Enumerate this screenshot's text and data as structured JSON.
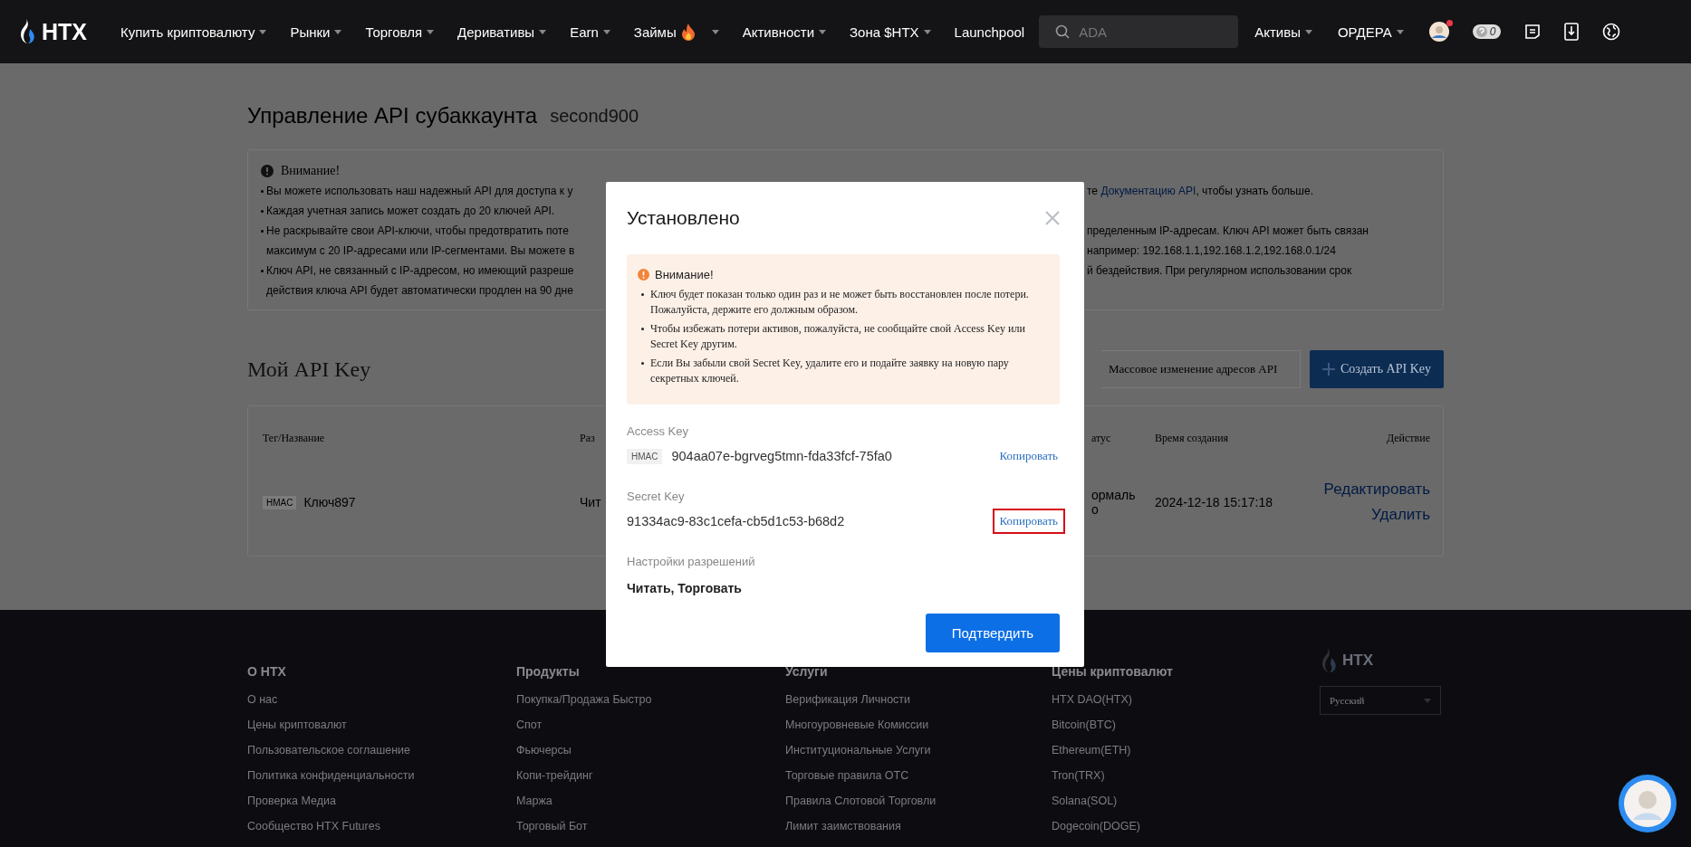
{
  "nav": {
    "logo": "HTX",
    "menu": [
      {
        "label": "Купить криптовалюту",
        "kind": "dropdown",
        "hot": false
      },
      {
        "label": "Рынки",
        "kind": "dropdown",
        "hot": false
      },
      {
        "label": "Торговля",
        "kind": "dropdown",
        "hot": false
      },
      {
        "label": "Деривативы",
        "kind": "dropdown",
        "hot": false
      },
      {
        "label": "Earn",
        "kind": "dropdown",
        "hot": false
      },
      {
        "label": "Займы",
        "kind": "dropdown",
        "hot": true
      },
      {
        "label": "Активности",
        "kind": "dropdown",
        "hot": false
      },
      {
        "label": "Зона $HTX",
        "kind": "dropdown",
        "hot": false
      },
      {
        "label": "Launchpool",
        "kind": "link",
        "hot": false
      }
    ],
    "search": {
      "placeholder": "ADA"
    },
    "right_menu": [
      {
        "label": "Активы",
        "kind": "dropdown"
      },
      {
        "label": "ОРДЕРА",
        "kind": "dropdown"
      }
    ],
    "account": {
      "notification": true
    },
    "counter": "0"
  },
  "page": {
    "title": "Управление API субаккаунта",
    "subaccount": "second900",
    "notice": {
      "title": "Внимание!",
      "lines": [
        {
          "bullet": true,
          "left": "Вы можете использовать наш надежный API для доступа к у",
          "right": [
            {
              "text": "те ",
              "link": false
            },
            {
              "text": "Документацию API",
              "link": true
            },
            {
              "text": ", чтобы узнать больше.",
              "link": false
            }
          ]
        },
        {
          "bullet": true,
          "left": "Каждая учетная запись может создать до 20 ключей API."
        },
        {
          "bullet": true,
          "left": "Не раскрывайте свои API-ключи, чтобы предотвратить поте",
          "right": [
            {
              "text": "пределенным IP-адресам. Ключ API может быть связан",
              "link": false
            }
          ]
        },
        {
          "bullet": false,
          "left": "максимум с 20 IP-адресами или IP-сегментами. Вы можете в",
          "right": [
            {
              "text": "например: 192.168.1.1,192.168.1.2,192.168.0.1/24",
              "link": false
            }
          ]
        },
        {
          "bullet": true,
          "left": "Ключ API, не связанный с IP-адресом, но имеющий разреше",
          "right": [
            {
              "text": "й бездействия. При регулярном использовании срок",
              "link": false
            }
          ]
        },
        {
          "bullet": false,
          "left": "действия ключа API будет автоматически продлен на 90 дне"
        }
      ]
    }
  },
  "api_keys": {
    "title": "Мой API Key",
    "buttons": [
      {
        "label": "Массовое изменение адресов API",
        "kind": "outline"
      },
      {
        "label": "Создать API Key",
        "kind": "primary"
      }
    ],
    "table": {
      "columns": [
        "Тег/Название",
        "Раз",
        "атус",
        "Время создания",
        "Действие"
      ],
      "rows": [
        {
          "badge": "HMAC",
          "name": "Ключ897",
          "column_2": "Чит",
          "column_3": [
            "ормаль",
            "о"
          ],
          "created": "2024-12-18 15:17:18",
          "actions": [
            "Редактировать",
            "Удалить"
          ]
        }
      ]
    }
  },
  "modal": {
    "title": "Установлено",
    "warning": {
      "title": "Внимание!",
      "items": [
        "Ключ будет показан только один раз и не может быть восстановлен после потери. Пожалуйста, держите его должным образом.",
        "Чтобы избежать потери активов, пожалуйста, не сообщайте свой Access Key или Secret Key другим.",
        "Если Вы забыли свой Secret Key, удалите его и подайте заявку на новую пару секретных ключей."
      ]
    },
    "keys": [
      {
        "label": "Access Key",
        "badge": "HMAC",
        "value": "904aa07e-bgrveg5tmn-fda33fcf-75fa0",
        "copy": "Копировать",
        "highlighted": false
      },
      {
        "label": "Secret Key",
        "value": "91334ac9-83c1cefa-cb5d1c53-b68d2",
        "copy": "Копировать",
        "highlighted": true
      }
    ],
    "permissions": {
      "label": "Настройки разрешений",
      "value": "Читать, Торговать"
    },
    "confirm": "Подтвердить"
  },
  "footer": {
    "columns": [
      {
        "title": "О HTX",
        "links": [
          "О нас",
          "Цены криптовалют",
          "Пользовательское соглашение",
          "Политика конфиденциальности",
          "Проверка Медиа",
          "Сообщество HTX Futures"
        ]
      },
      {
        "title": "Продукты",
        "links": [
          "Покупка/Продажа Быстро",
          "Спот",
          "Фьючерсы",
          "Копи-трейдинг",
          "Маржа",
          "Торговый Бот"
        ]
      },
      {
        "title": "Услуги",
        "links": [
          "Верификация Личности",
          "Многоуровневые Комиссии",
          "Институциональные Услуги",
          "Торговые правила OTC",
          "Правила Слотовой Торговли",
          "Лимит заимствования"
        ]
      },
      {
        "title": "Цены криптовалют",
        "links": [
          "HTX DAO(HTX)",
          "Bitcoin(BTC)",
          "Ethereum(ETH)",
          "Tron(TRX)",
          "Solana(SOL)",
          "Dogecoin(DOGE)"
        ]
      }
    ],
    "logo": "HTX",
    "language": "Русский"
  }
}
